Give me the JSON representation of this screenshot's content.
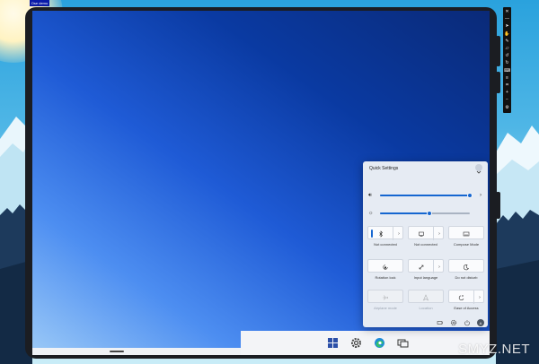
{
  "demo_badge": "Ose demo",
  "quick_settings": {
    "title": "Quick Settings",
    "volume": 100,
    "brightness": 55,
    "tiles": [
      {
        "name": "bluetooth",
        "label": "Not connected",
        "split": true,
        "enabled": true,
        "active_indicator": true,
        "icon": "bluetooth-icon"
      },
      {
        "name": "network",
        "label": "Not connected",
        "split": true,
        "enabled": true,
        "active_indicator": false,
        "icon": "network-icon"
      },
      {
        "name": "compose-mode",
        "label": "Compose Mode",
        "split": false,
        "enabled": true,
        "active_indicator": false,
        "icon": "compose-mode-icon"
      },
      {
        "name": "rotation-lock",
        "label": "Rotation lock",
        "split": false,
        "enabled": true,
        "active_indicator": false,
        "icon": "rotation-lock-icon"
      },
      {
        "name": "input-language",
        "label": "Input language",
        "split": true,
        "enabled": true,
        "active_indicator": false,
        "icon": "input-language-icon"
      },
      {
        "name": "do-not-disturb",
        "label": "Do not disturb",
        "split": false,
        "enabled": true,
        "active_indicator": false,
        "icon": "moon-icon"
      },
      {
        "name": "airplane-mode",
        "label": "Airplane mode",
        "split": false,
        "enabled": false,
        "active_indicator": false,
        "icon": "airplane-icon"
      },
      {
        "name": "location",
        "label": "Location",
        "split": false,
        "enabled": false,
        "active_indicator": false,
        "icon": "location-icon"
      },
      {
        "name": "ease-of-access",
        "label": "Ease of Access",
        "split": true,
        "enabled": true,
        "active_indicator": false,
        "icon": "ease-of-access-icon"
      }
    ],
    "footer_icons": [
      "battery-icon",
      "settings-icon",
      "power-icon",
      "user-avatar-icon"
    ],
    "avatar_initial": "A"
  },
  "taskbar_icons": [
    "start-icon",
    "settings-icon",
    "edge-icon",
    "task-view-icon"
  ],
  "toolbar_tools": [
    "close",
    "minimize",
    "pointer",
    "pan",
    "pen",
    "eraser",
    "rotate-left",
    "rotate-right",
    "keyboard",
    "menu",
    "screenshot",
    "zoom-in",
    "zoom-out",
    "settings"
  ],
  "watermark": "SMYZ.NET",
  "colors": {
    "accent": "#1566d0",
    "panel": "#e6ebf3"
  }
}
